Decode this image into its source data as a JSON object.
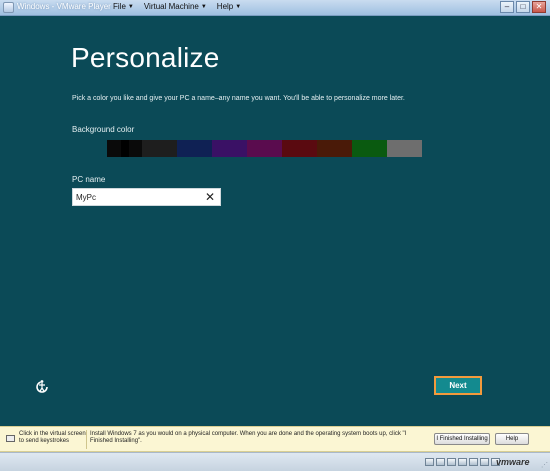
{
  "window": {
    "title": "Windows - VMware Player",
    "menus": [
      {
        "label": "File"
      },
      {
        "label": "Virtual Machine"
      },
      {
        "label": "Help"
      }
    ]
  },
  "setup": {
    "heading": "Personalize",
    "description": "Pick a color you like and give your PC a name–any name you want. You'll be able to personalize more later.",
    "background_color_label": "Background color",
    "swatches": [
      "#0b4a57",
      "#0a0a0a",
      "#1e1e1e",
      "#0f2154",
      "#3a1165",
      "#5a0c4e",
      "#5a0a10",
      "#4a1a08",
      "#0a5a10",
      "#6e6e6e"
    ],
    "selected_swatch_index": 1,
    "pc_name_label": "PC name",
    "pc_name_value": "MyPc",
    "next_label": "Next"
  },
  "hint_bar": {
    "left_text": "Click in the virtual screen to send keystrokes",
    "main_text": "Install Windows 7 as you would on a physical computer. When you are done and the operating system boots up, click \"I Finished Installing\".",
    "finished_button": "I Finished Installing",
    "help_button": "Help"
  },
  "status_bar": {
    "brand": "vmware",
    "device_icons": [
      "hard-disk-icon",
      "cd-drive-icon",
      "floppy-icon",
      "network-icon",
      "usb-icon",
      "sound-icon",
      "printer-icon"
    ]
  }
}
